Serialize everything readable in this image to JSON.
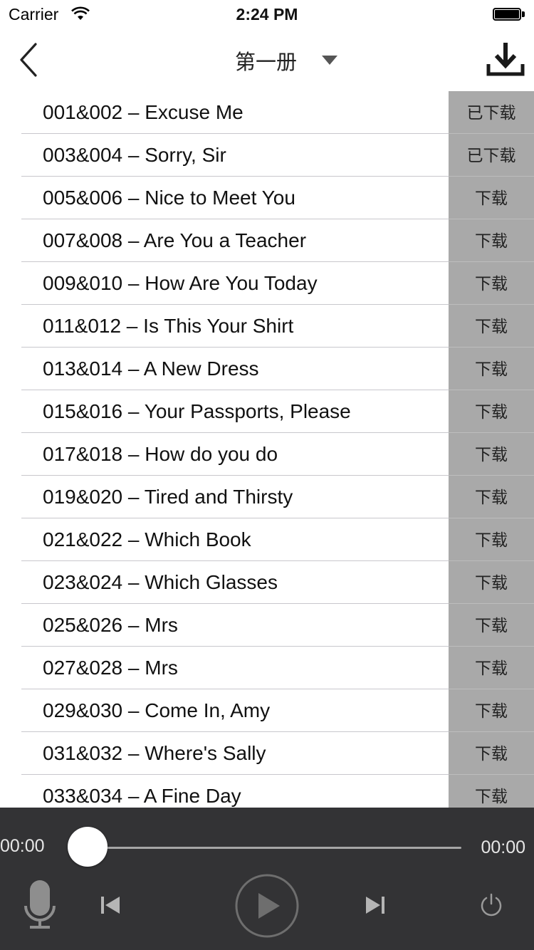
{
  "status_bar": {
    "carrier": "Carrier",
    "time": "2:24 PM"
  },
  "nav": {
    "title": "第一册"
  },
  "lessons": [
    {
      "title": "001&002 – Excuse Me",
      "action": "已下载"
    },
    {
      "title": "003&004 – Sorry, Sir",
      "action": "已下载"
    },
    {
      "title": "005&006 – Nice to Meet You",
      "action": "下载"
    },
    {
      "title": "007&008 – Are You a Teacher",
      "action": "下载"
    },
    {
      "title": "009&010 – How Are You Today",
      "action": "下载"
    },
    {
      "title": "011&012 – Is This Your Shirt",
      "action": "下载"
    },
    {
      "title": "013&014 – A New Dress",
      "action": "下载"
    },
    {
      "title": "015&016 – Your Passports, Please",
      "action": "下载"
    },
    {
      "title": "017&018 – How do you do",
      "action": "下载"
    },
    {
      "title": "019&020 – Tired and Thirsty",
      "action": "下载"
    },
    {
      "title": "021&022 – Which Book",
      "action": "下载"
    },
    {
      "title": "023&024 – Which Glasses",
      "action": "下载"
    },
    {
      "title": "025&026 – Mrs",
      "action": "下载"
    },
    {
      "title": "027&028 – Mrs",
      "action": "下载"
    },
    {
      "title": "029&030 – Come In, Amy",
      "action": "下载"
    },
    {
      "title": "031&032 – Where's Sally",
      "action": "下载"
    },
    {
      "title": "033&034 – A Fine Day",
      "action": "下载"
    }
  ],
  "player": {
    "current_time": "00:00",
    "total_time": "00:00",
    "progress": 0,
    "icons": [
      "microphone-icon",
      "previous-track-icon",
      "play-icon",
      "next-track-icon",
      "power-icon"
    ]
  },
  "colors": {
    "download_cell": "#a9a9a9",
    "player_bg": "#333335",
    "separator": "#c8c7cc"
  }
}
